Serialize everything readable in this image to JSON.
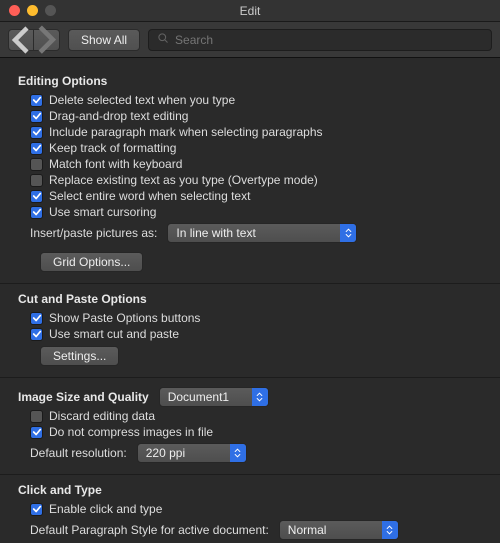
{
  "window": {
    "title": "Edit"
  },
  "toolbar": {
    "show_all": "Show All",
    "search_placeholder": "Search"
  },
  "sections": {
    "editing": {
      "title": "Editing Options",
      "items": [
        {
          "label": "Delete selected text when you type",
          "checked": true
        },
        {
          "label": "Drag-and-drop text editing",
          "checked": true
        },
        {
          "label": "Include paragraph mark when selecting paragraphs",
          "checked": true
        },
        {
          "label": "Keep track of formatting",
          "checked": true
        },
        {
          "label": "Match font with keyboard",
          "checked": false
        },
        {
          "label": "Replace existing text as you type (Overtype mode)",
          "checked": false
        },
        {
          "label": "Select entire word when selecting text",
          "checked": true
        },
        {
          "label": "Use smart cursoring",
          "checked": true
        }
      ],
      "insert_label": "Insert/paste pictures as:",
      "insert_value": "In line with text",
      "grid_btn": "Grid Options..."
    },
    "cutpaste": {
      "title": "Cut and Paste Options",
      "items": [
        {
          "label": "Show Paste Options buttons",
          "checked": true
        },
        {
          "label": "Use smart cut and paste",
          "checked": true
        }
      ],
      "settings_btn": "Settings..."
    },
    "image": {
      "title": "Image Size and Quality",
      "doc_value": "Document1",
      "items": [
        {
          "label": "Discard editing data",
          "checked": false
        },
        {
          "label": "Do not compress images in file",
          "checked": true
        }
      ],
      "res_label": "Default resolution:",
      "res_value": "220 ppi"
    },
    "clicktype": {
      "title": "Click and Type",
      "items": [
        {
          "label": "Enable click and type",
          "checked": true
        }
      ],
      "para_label": "Default Paragraph Style for active document:",
      "para_value": "Normal"
    }
  }
}
